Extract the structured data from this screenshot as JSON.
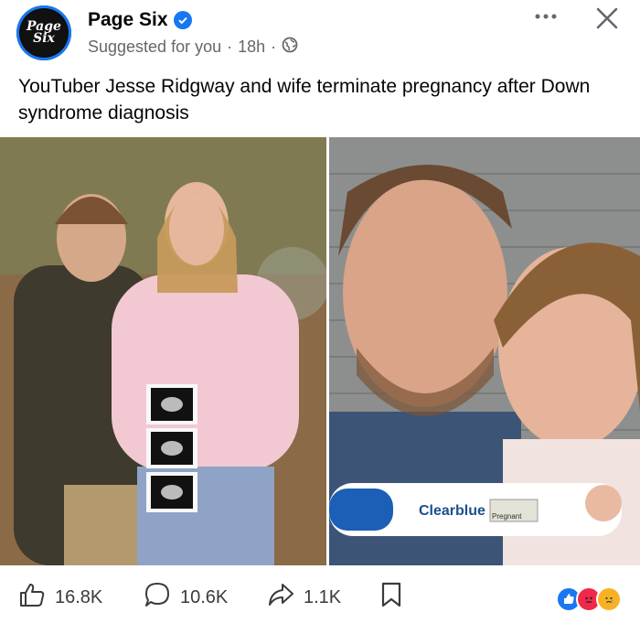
{
  "post": {
    "page_name": "Page Six",
    "avatar_text_line1": "Page",
    "avatar_text_line2": "Six",
    "suggested": "Suggested for you",
    "separator": "·",
    "time": "18h",
    "text": "YouTuber Jesse Ridgway and wife terminate pregnancy after Down syndrome diagnosis"
  },
  "photo_right": {
    "test_brand": "Clearblue",
    "test_result": "Pregnant"
  },
  "actions": {
    "likes": "16.8K",
    "comments": "10.6K",
    "shares": "1.1K"
  },
  "colors": {
    "accent": "#1877f2",
    "secondary_text": "#65676b"
  },
  "icons": [
    "globe-icon",
    "verified-badge-icon",
    "more-icon",
    "close-icon",
    "like-icon",
    "comment-icon",
    "share-icon",
    "save-icon"
  ]
}
